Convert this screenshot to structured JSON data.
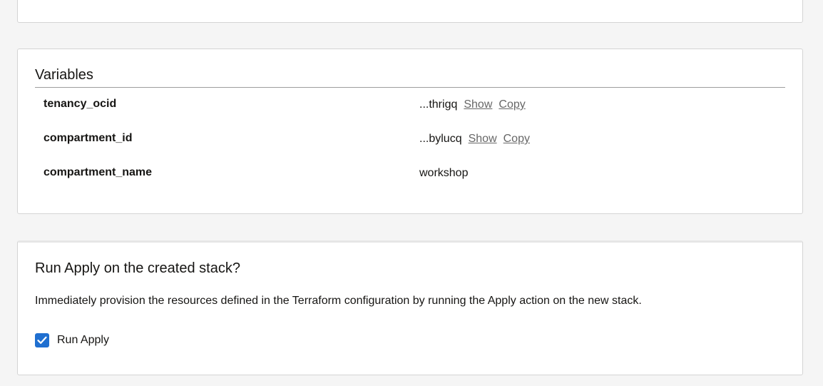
{
  "variables": {
    "title": "Variables",
    "rows": [
      {
        "name": "tenancy_ocid",
        "value": "...thrigq",
        "show": "Show",
        "copy": "Copy"
      },
      {
        "name": "compartment_id",
        "value": "...bylucq",
        "show": "Show",
        "copy": "Copy"
      },
      {
        "name": "compartment_name",
        "value": "workshop"
      }
    ]
  },
  "apply": {
    "title": "Run Apply on the created stack?",
    "description": "Immediately provision the resources defined in the Terraform configuration by running the Apply action on the new stack.",
    "checkbox_label": "Run Apply",
    "checked": true
  },
  "colors": {
    "accent": "#1f6fd0",
    "link": "#676767",
    "background": "#f5f5f5"
  },
  "icons": {
    "checkbox": "checkmark-icon"
  }
}
